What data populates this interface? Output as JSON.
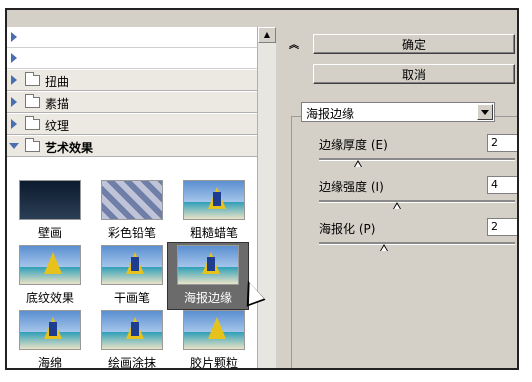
{
  "buttons": {
    "ok": "确定",
    "cancel": "取消"
  },
  "filter_select": {
    "value": "海报边缘"
  },
  "categories": [
    {
      "label": "扭曲",
      "expanded": false
    },
    {
      "label": "素描",
      "expanded": false
    },
    {
      "label": "纹理",
      "expanded": false
    },
    {
      "label": "艺术效果",
      "expanded": true
    }
  ],
  "thumbnails": [
    {
      "label": "壁画",
      "selected": false
    },
    {
      "label": "彩色铅笔",
      "selected": false
    },
    {
      "label": "粗糙蜡笔",
      "selected": false
    },
    {
      "label": "底纹效果",
      "selected": false
    },
    {
      "label": "干画笔",
      "selected": false
    },
    {
      "label": "海报边缘",
      "selected": true
    },
    {
      "label": "海绵",
      "selected": false
    },
    {
      "label": "绘画涂抹",
      "selected": false
    },
    {
      "label": "胶片颗粒",
      "selected": false
    }
  ],
  "params": [
    {
      "label": "边缘厚度",
      "mnemonic": "(E)",
      "value": "2",
      "fraction": 0.2
    },
    {
      "label": "边缘强度",
      "mnemonic": "(I)",
      "value": "4",
      "fraction": 0.4
    },
    {
      "label": "海报化",
      "mnemonic": "(P)",
      "value": "2",
      "fraction": 0.33
    }
  ],
  "icons": {
    "collapse": "double-chevron-up-icon",
    "folder": "folder-icon",
    "scroll_up": "scroll-up-arrow-icon"
  }
}
